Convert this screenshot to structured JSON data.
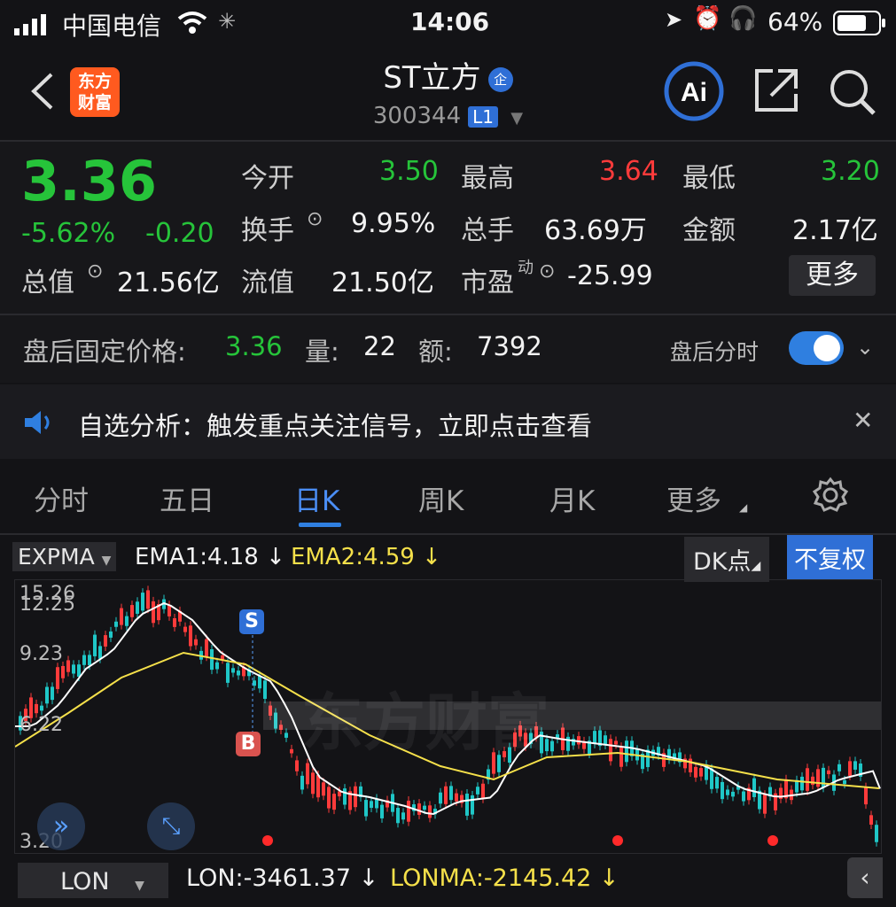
{
  "status_bar": {
    "carrier": "中国电信",
    "time": "14:06",
    "battery": "64%"
  },
  "header": {
    "logo_text": "东方财富",
    "stock_name": "ST立方",
    "badge": "企",
    "stock_code": "300344",
    "level": "L1"
  },
  "quote": {
    "price": "3.36",
    "change_pct": "-5.62%",
    "change": "-0.20",
    "open_label": "今开",
    "open": "3.50",
    "high_label": "最高",
    "high": "3.64",
    "low_label": "最低",
    "low": "3.20",
    "turnover_label": "换手",
    "turnover": "9.95%",
    "volume_label": "总手",
    "volume": "63.69万",
    "amount_label": "金额",
    "amount": "2.17亿",
    "mktcap_label": "总值",
    "mktcap": "21.56亿",
    "float_label": "流值",
    "float_cap": "21.50亿",
    "pe_label": "市盈",
    "pe_sup": "动",
    "pe": "-25.99",
    "more_button": "更多"
  },
  "after_hours": {
    "label": "盘后固定价格:",
    "price": "3.36",
    "vol_label": "量:",
    "vol": "22",
    "amt_label": "额:",
    "amt": "7392",
    "toggle_label": "盘后分时"
  },
  "notice": {
    "text": "自选分析：触发重点关注信号，立即点击查看"
  },
  "tabs": [
    "分时",
    "五日",
    "日K",
    "周K",
    "月K",
    "更多"
  ],
  "indicator": {
    "name": "EXPMA",
    "ema1": "EMA1:4.18",
    "ema2": "EMA2:4.59",
    "dk": "DK点",
    "adjust": "不复权"
  },
  "chart_data": {
    "type": "candlestick",
    "y_ticks": [
      "15.26",
      "12.25",
      "9.23",
      "6.22",
      "3.20"
    ],
    "markers": [
      "S",
      "B"
    ],
    "watermark": "东方财富",
    "ema1_color": "#ffffff",
    "ema2_color": "#f5e04a"
  },
  "lon_bar": {
    "name": "LON",
    "lon": "LON:-3461.37",
    "lonma": "LONMA:-2145.42"
  }
}
